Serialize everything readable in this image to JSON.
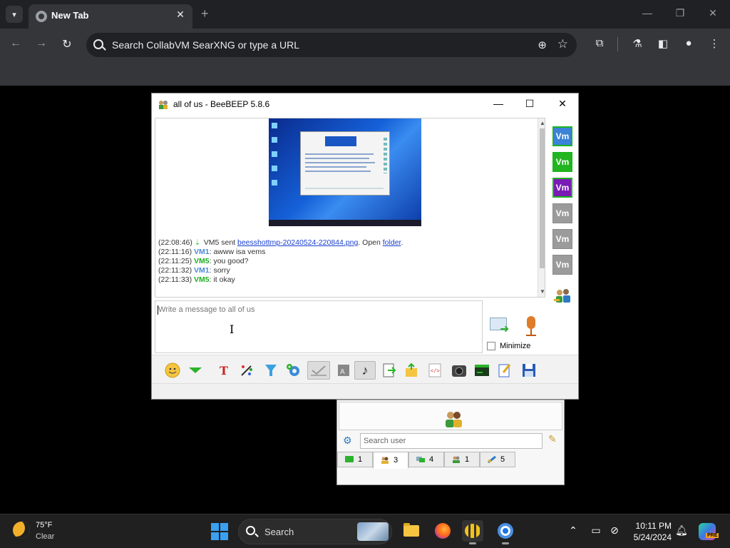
{
  "browser": {
    "tab_title": "New Tab",
    "omnibox_text": "Search CollabVM SearXNG or type a URL"
  },
  "chat_window": {
    "title": "all of us - BeeBEEP 5.8.6",
    "messages": [
      {
        "time": "(22:08:46)",
        "text": "VM5 sent ",
        "file": "beesshottmp-20240524-220844.png",
        "after": ". Open ",
        "link": "folder",
        "end": "."
      },
      {
        "time": "(22:11:16)",
        "user": "VM1",
        "text": ": awww isa vems"
      },
      {
        "time": "(22:11:25)",
        "user": "VM5",
        "text": ": you good?"
      },
      {
        "time": "(22:11:32)",
        "user": "VM1",
        "text": ": sorry"
      },
      {
        "time": "(22:11:33)",
        "user": "VM5",
        "text": ": it okay"
      }
    ],
    "compose_placeholder": "Write a message to all of us",
    "minimize_label": "Minimize",
    "users": [
      "Vm",
      "Vm",
      "Vm",
      "Vm",
      "Vm",
      "Vm"
    ]
  },
  "user_panel": {
    "search_placeholder": "Search user",
    "tabs": [
      {
        "icon": "chat-icon",
        "count": "1"
      },
      {
        "icon": "users-icon",
        "count": "3"
      },
      {
        "icon": "groups-icon",
        "count": "4"
      },
      {
        "icon": "group-chat-icon",
        "count": "1"
      },
      {
        "icon": "network-icon",
        "count": "5"
      }
    ]
  },
  "taskbar": {
    "temp": "75°F",
    "condition": "Clear",
    "search_label": "Search",
    "time": "10:11 PM",
    "date": "5/24/2024",
    "copilot_badge": "PRE"
  }
}
